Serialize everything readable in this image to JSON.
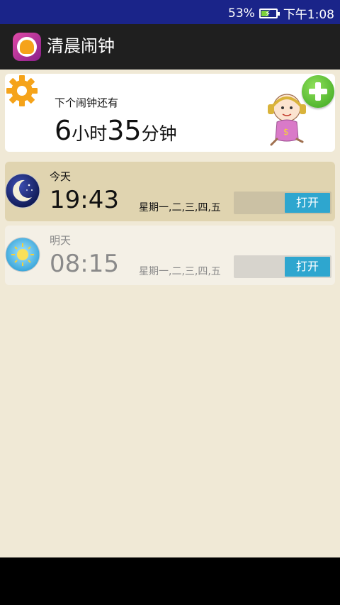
{
  "status_bar": {
    "battery_percent": "53%",
    "battery_level": 0.53,
    "time": "下午1:08"
  },
  "app_bar": {
    "title": "清晨闹钟",
    "icon": "alarm-bell-app-icon"
  },
  "next_alarm": {
    "label": "下个闹钟还有",
    "hours": "6",
    "hours_unit": "小时",
    "minutes": "35",
    "minutes_unit": "分钟",
    "settings_icon": "gear-icon",
    "add_icon": "plus-icon",
    "mascot_icon": "baby-headphones-icon"
  },
  "alarms": [
    {
      "day": "今天",
      "time": "19:43",
      "repeat": "星期一,二,三,四,五",
      "toggle_label": "打开",
      "icon": "moon-icon"
    },
    {
      "day": "明天",
      "time": "08:15",
      "repeat": "星期一,二,三,四,五",
      "toggle_label": "打开",
      "icon": "sun-icon"
    }
  ],
  "colors": {
    "status_bar": "#1a2489",
    "app_bar": "#1f1f1f",
    "background": "#f0e9d6",
    "toggle_accent": "#2ea6cf",
    "add_button": "#4cb82a"
  }
}
